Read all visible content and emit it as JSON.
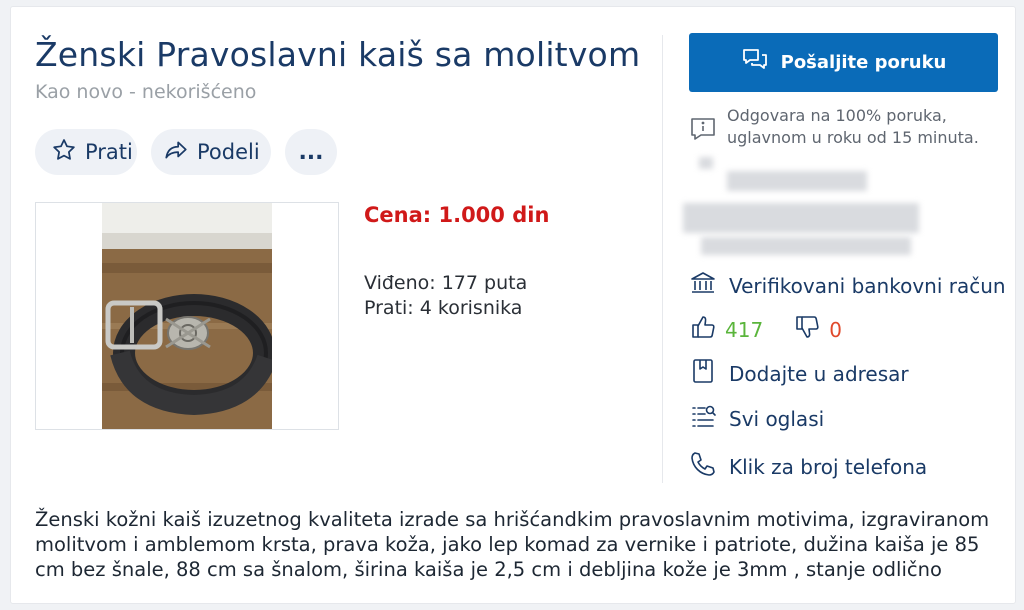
{
  "listing": {
    "title": "Ženski Pravoslavni kaiš sa molitvom",
    "condition": "Kao novo - nekorišćeno",
    "price": "Cena: 1.000 din",
    "views": "Viđeno: 177 puta",
    "followers": "Prati: 4 korisnika",
    "description": "Ženski kožni kaiš izuzetnog kvaliteta izrade sa hrišćandkim pravoslavnim motivima, izgraviranom molitvom i amblemom krsta, prava koža, jako lep komad za vernike i patriote, dužina kaiša je 85 cm bez šnale, 88 cm sa šnalom, širina kaiša je 2,5 cm i debljina kože je 3mm , stanje odlično"
  },
  "actions": {
    "follow_label": "Prati",
    "share_label": "Podeli",
    "more_label": "..."
  },
  "seller": {
    "message_button": "Pošaljite poruku",
    "response_rate": "Odgovara na 100% poruka, uglavnom u roku od 15 minuta.",
    "verified_bank": "Verifikovani bankovni račun",
    "positive_ratings": "417",
    "negative_ratings": "0",
    "add_to_contacts": "Dodajte u adresar",
    "all_ads": "Svi oglasi",
    "phone": "Klik za broj telefona"
  },
  "colors": {
    "accent": "#0a6bb8",
    "price": "#d01919",
    "positive": "#5ab53b",
    "negative": "#e0492b",
    "title": "#1a3a66"
  },
  "icons": [
    "star-icon",
    "share-icon",
    "chat-icon",
    "info-chat-icon",
    "bank-icon",
    "thumbs-up-icon",
    "thumbs-down-icon",
    "bookmark-icon",
    "list-icon",
    "phone-icon"
  ]
}
